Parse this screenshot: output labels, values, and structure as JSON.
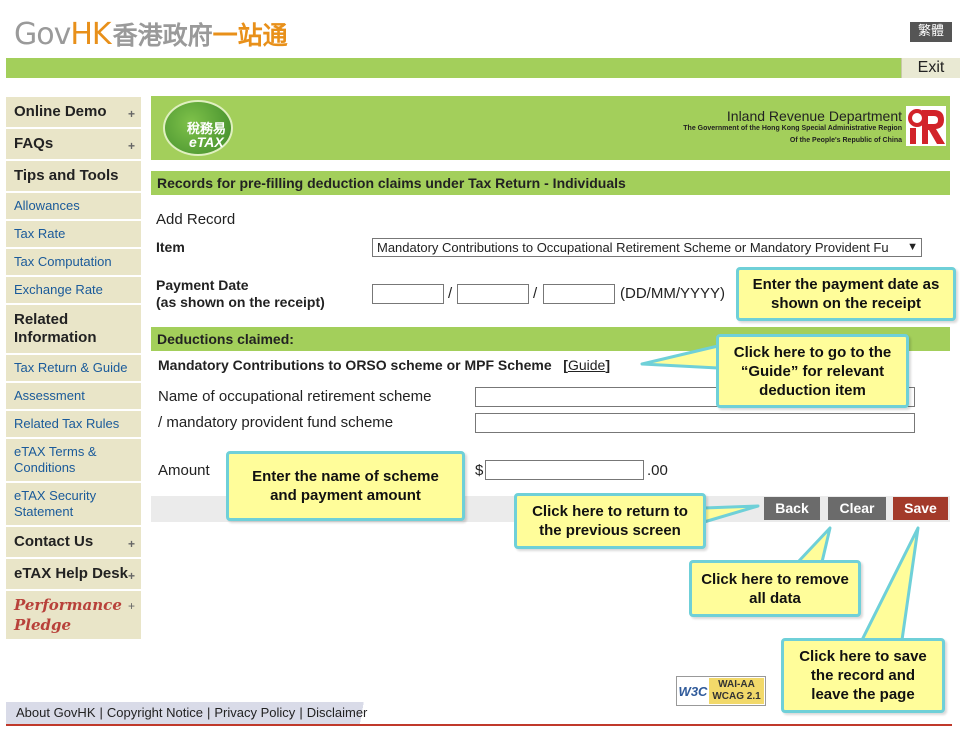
{
  "header": {
    "logo_gov": "Gov",
    "logo_hk": "HK",
    "logo_zh_part1": "香港政府",
    "logo_zh_part2": "一站通",
    "lang_button": "繁體",
    "exit_button": "Exit"
  },
  "sidebar": {
    "items": [
      {
        "label": "Online Demo",
        "type": "major",
        "expand": true
      },
      {
        "label": "FAQs",
        "type": "major",
        "expand": true
      },
      {
        "label": "Tips and Tools",
        "type": "major",
        "expand": false
      },
      {
        "label": "Allowances",
        "type": "minor"
      },
      {
        "label": "Tax Rate",
        "type": "minor"
      },
      {
        "label": "Tax Computation",
        "type": "minor"
      },
      {
        "label": "Exchange Rate",
        "type": "minor"
      },
      {
        "label": "Related Information",
        "type": "major",
        "expand": false
      },
      {
        "label": "Tax Return & Guide",
        "type": "minor"
      },
      {
        "label": "Assessment",
        "type": "minor"
      },
      {
        "label": "Related Tax Rules",
        "type": "minor"
      },
      {
        "label": "eTAX Terms & Conditions",
        "type": "minor"
      },
      {
        "label": "eTAX Security Statement",
        "type": "minor"
      },
      {
        "label": "Contact Us",
        "type": "major",
        "expand": true
      },
      {
        "label": "eTAX Help Desk",
        "type": "major",
        "expand": true
      },
      {
        "label": "Performance Pledge",
        "type": "pledge",
        "expand": true
      }
    ],
    "expand_symbol": "+"
  },
  "banner": {
    "etax_zh": "稅務易",
    "etax_en": "eTAX",
    "dept_title": "Inland Revenue Department",
    "dept_sub1": "The Government of the Hong Kong Special Administrative Region",
    "dept_sub2": "Of the People's Republic of China"
  },
  "form": {
    "section_title": "Records for pre-filling deduction claims under Tax Return - Individuals",
    "add_record": "Add Record",
    "item_label": "Item",
    "item_selected": "Mandatory Contributions to Occupational Retirement Scheme or Mandatory Provident Fu",
    "payment_date_label": "Payment Date",
    "payment_date_sub": "(as shown on the receipt)",
    "date_sep": "/",
    "date_format": "(DD/MM/YYYY)",
    "deductions_title": "Deductions claimed:",
    "mpf_heading": "Mandatory Contributions to ORSO scheme or MPF Scheme",
    "guide_open": "[",
    "guide_link": "Guide",
    "guide_close": "]",
    "scheme_label_1": "Name of occupational retirement scheme",
    "scheme_label_2": "/ mandatory provident fund scheme",
    "amount_label": "Amount",
    "currency": "$",
    "cents": ".00"
  },
  "buttons": {
    "back": "Back",
    "clear": "Clear",
    "save": "Save"
  },
  "callouts": {
    "payment_date": "Enter the payment date as shown on the receipt",
    "guide": "Click here to go to the “Guide” for relevant deduction item",
    "scheme": "Enter the name of scheme and payment amount",
    "back": "Click here to return to the previous screen",
    "clear": "Click here to remove all data",
    "save": "Click here to save the record and leave the page"
  },
  "footer": {
    "w3c": "W3C",
    "wai": "WAI-AA",
    "wcag": "WCAG 2.1",
    "links": [
      "About GovHK",
      "Copyright Notice",
      "Privacy Policy",
      "Disclaimer"
    ],
    "separator": "|"
  }
}
